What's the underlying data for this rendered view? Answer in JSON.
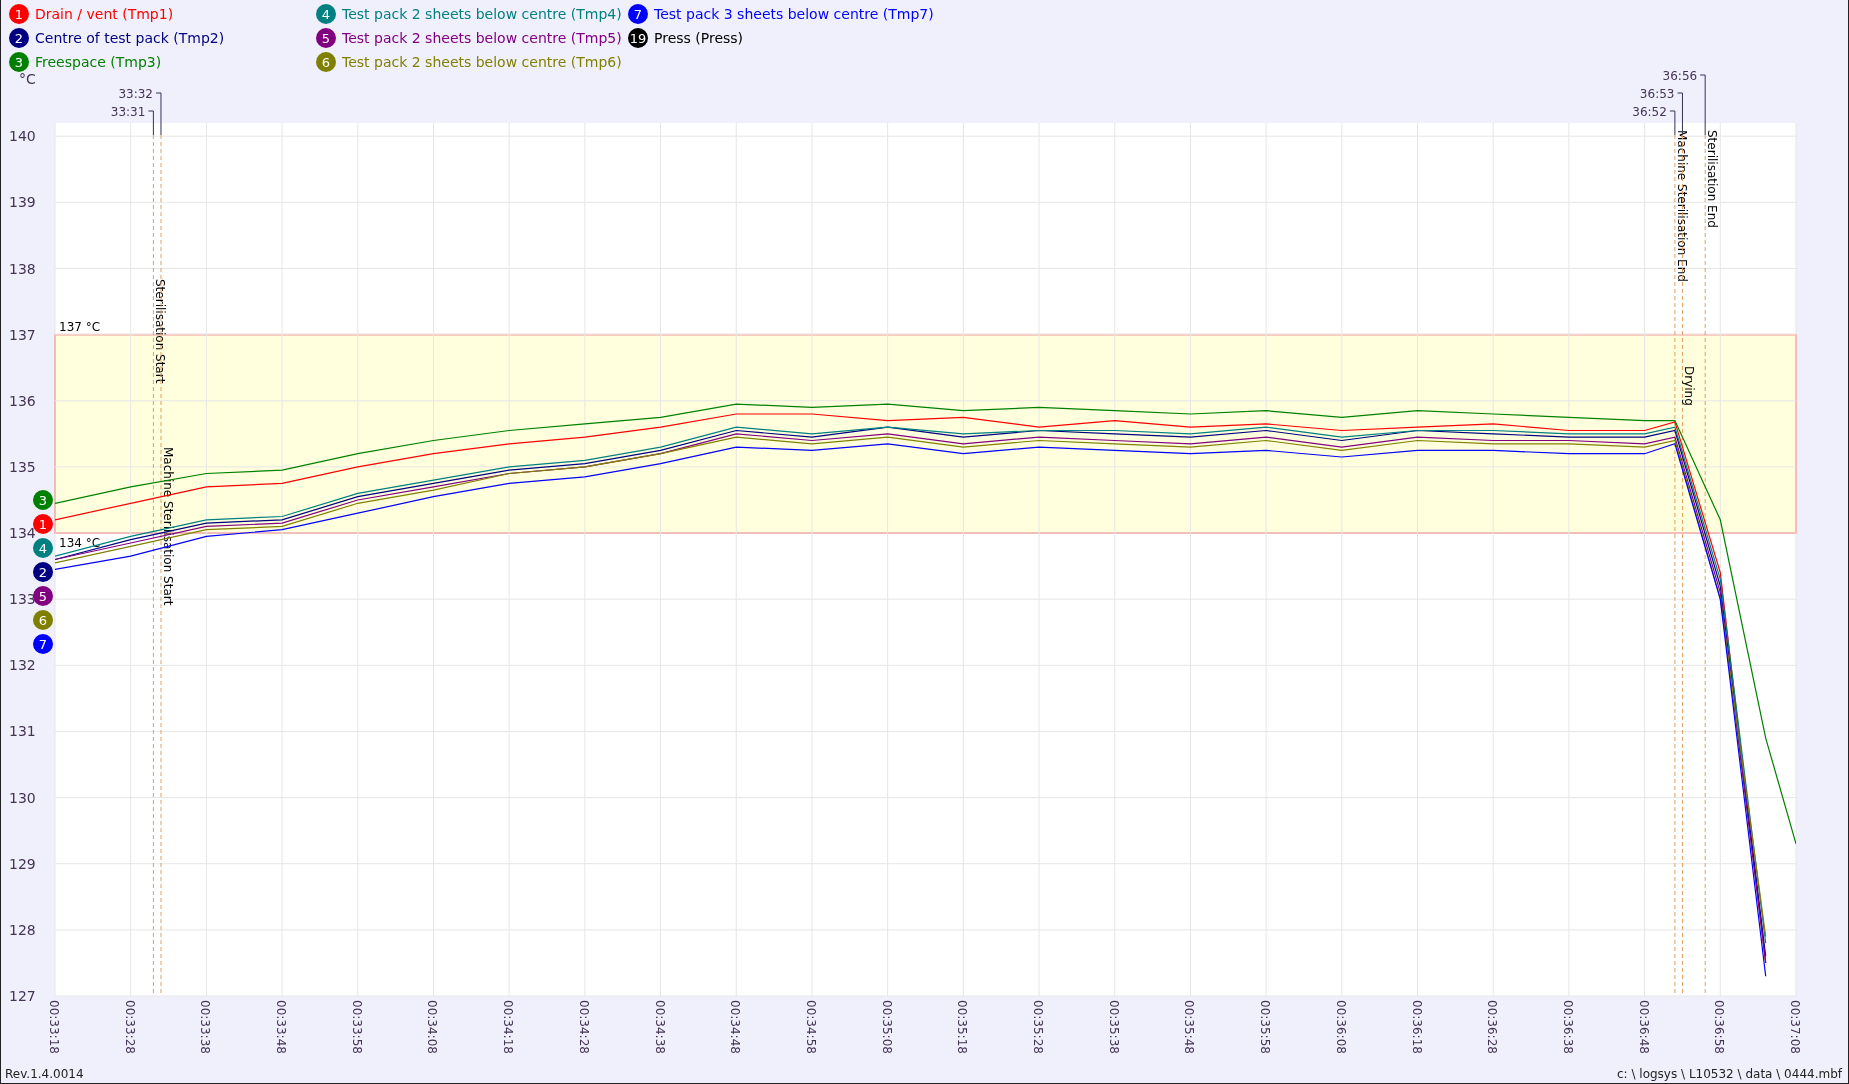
{
  "legend": [
    {
      "number": "1"
    },
    {
      "number": "2"
    },
    {
      "number": "3"
    },
    {
      "number": "4"
    },
    {
      "number": "5"
    },
    {
      "number": "6"
    },
    {
      "number": "7"
    }
  ],
  "extra_legend": {
    "number": "19",
    "label": "Press (Press)",
    "color": "#000000"
  },
  "series_badges": [
    {
      "text": "3",
      "color": "#008000"
    },
    {
      "text": "1",
      "color": "#ff0000"
    },
    {
      "text": "4",
      "color": "#008080"
    },
    {
      "text": "2",
      "color": "#000080"
    },
    {
      "text": "5",
      "color": "#800080"
    },
    {
      "text": "6",
      "color": "#808000"
    },
    {
      "text": "7",
      "color": "#0000ff"
    }
  ],
  "chart_data": {
    "type": "line",
    "ylabel": "°C",
    "x": [
      1998,
      2008,
      2018,
      2028,
      2038,
      2048,
      2058,
      2068,
      2078,
      2088,
      2098,
      2108,
      2118,
      2128,
      2138,
      2148,
      2158,
      2168,
      2178,
      2188,
      2198,
      2208,
      2212,
      2218,
      2224,
      2228
    ],
    "series": [
      {
        "name": "Drain / vent (Tmp1)",
        "color": "#ff0000",
        "values": [
          134.2,
          134.45,
          134.7,
          134.75,
          135.0,
          135.2,
          135.35,
          135.45,
          135.6,
          135.8,
          135.8,
          135.7,
          135.75,
          135.6,
          135.7,
          135.6,
          135.65,
          135.55,
          135.6,
          135.65,
          135.55,
          135.55,
          135.68,
          133.4,
          127.5,
          null
        ]
      },
      {
        "name": "Centre of test pack (Tmp2)",
        "color": "#000080",
        "values": [
          133.6,
          133.9,
          134.15,
          134.2,
          134.55,
          134.75,
          134.95,
          135.05,
          135.25,
          135.55,
          135.45,
          135.6,
          135.45,
          135.55,
          135.5,
          135.45,
          135.55,
          135.4,
          135.55,
          135.5,
          135.45,
          135.45,
          135.55,
          133.2,
          127.6,
          null
        ]
      },
      {
        "name": "Freespace (Tmp3)",
        "color": "#008000",
        "values": [
          134.45,
          134.7,
          134.9,
          134.95,
          135.2,
          135.4,
          135.55,
          135.65,
          135.75,
          135.95,
          135.9,
          135.95,
          135.85,
          135.9,
          135.85,
          135.8,
          135.85,
          135.75,
          135.85,
          135.8,
          135.75,
          135.7,
          135.7,
          134.2,
          130.9,
          129.3
        ]
      },
      {
        "name": "Test pack 2 sheets below centre (Tmp4)",
        "color": "#008080",
        "values": [
          133.65,
          133.95,
          134.2,
          134.25,
          134.6,
          134.8,
          135.0,
          135.1,
          135.3,
          135.6,
          135.5,
          135.6,
          135.5,
          135.55,
          135.55,
          135.5,
          135.6,
          135.45,
          135.55,
          135.55,
          135.5,
          135.5,
          135.6,
          133.3,
          127.8,
          null
        ]
      },
      {
        "name": "Test pack 2 sheets below centre (Tmp5)",
        "color": "#800080",
        "values": [
          133.6,
          133.85,
          134.1,
          134.15,
          134.5,
          134.7,
          134.9,
          135.0,
          135.2,
          135.5,
          135.4,
          135.5,
          135.35,
          135.45,
          135.4,
          135.35,
          135.45,
          135.3,
          135.45,
          135.4,
          135.4,
          135.35,
          135.45,
          133.1,
          127.5,
          null
        ]
      },
      {
        "name": "Test pack 2 sheets below centre (Tmp6)",
        "color": "#808000",
        "values": [
          133.55,
          133.8,
          134.05,
          134.1,
          134.45,
          134.65,
          134.9,
          135.0,
          135.2,
          135.45,
          135.35,
          135.45,
          135.3,
          135.4,
          135.35,
          135.3,
          135.4,
          135.25,
          135.4,
          135.35,
          135.35,
          135.3,
          135.4,
          133.0,
          127.9,
          null
        ]
      },
      {
        "name": "Test pack 3 sheets below centre (Tmp7)",
        "color": "#0000ff",
        "values": [
          133.45,
          133.65,
          133.95,
          134.05,
          134.3,
          134.55,
          134.75,
          134.85,
          135.05,
          135.3,
          135.25,
          135.35,
          135.2,
          135.3,
          135.25,
          135.2,
          135.25,
          135.15,
          135.25,
          135.25,
          135.2,
          135.2,
          135.35,
          133.0,
          127.3,
          null
        ]
      }
    ],
    "xlim": [
      1998,
      2228
    ],
    "ylim": [
      127,
      140.2
    ],
    "xticks": [
      {
        "value": 1998,
        "label": "00:33:18"
      },
      {
        "value": 2008,
        "label": "00:33:28"
      },
      {
        "value": 2018,
        "label": "00:33:38"
      },
      {
        "value": 2028,
        "label": "00:33:48"
      },
      {
        "value": 2038,
        "label": "00:33:58"
      },
      {
        "value": 2048,
        "label": "00:34:08"
      },
      {
        "value": 2058,
        "label": "00:34:18"
      },
      {
        "value": 2068,
        "label": "00:34:28"
      },
      {
        "value": 2078,
        "label": "00:34:38"
      },
      {
        "value": 2088,
        "label": "00:34:48"
      },
      {
        "value": 2098,
        "label": "00:34:58"
      },
      {
        "value": 2108,
        "label": "00:35:08"
      },
      {
        "value": 2118,
        "label": "00:35:18"
      },
      {
        "value": 2128,
        "label": "00:35:28"
      },
      {
        "value": 2138,
        "label": "00:35:38"
      },
      {
        "value": 2148,
        "label": "00:35:48"
      },
      {
        "value": 2158,
        "label": "00:35:58"
      },
      {
        "value": 2168,
        "label": "00:36:08"
      },
      {
        "value": 2178,
        "label": "00:36:18"
      },
      {
        "value": 2188,
        "label": "00:36:28"
      },
      {
        "value": 2198,
        "label": "00:36:38"
      },
      {
        "value": 2208,
        "label": "00:36:48"
      },
      {
        "value": 2218,
        "label": "00:36:58"
      },
      {
        "value": 2228,
        "label": "00:37:08"
      }
    ],
    "yticks": [
      127,
      128,
      129,
      130,
      131,
      132,
      133,
      134,
      135,
      136,
      137,
      138,
      139,
      140
    ],
    "grid": true,
    "bands": [
      {
        "axis": "y",
        "from": 134,
        "to": 137
      }
    ],
    "ref_lines": [
      {
        "axis": "x",
        "value": 2011,
        "label": "Sterilisation Start"
      },
      {
        "axis": "x",
        "value": 2012,
        "label": "Machine Sterilisation Start"
      },
      {
        "axis": "x",
        "value": 2212,
        "label": "Machine Sterilisation End"
      },
      {
        "axis": "x",
        "value": 2213,
        "label": "Drying"
      },
      {
        "axis": "x",
        "value": 2216,
        "label": "Sterilisation End"
      }
    ]
  },
  "band_labels": [
    {
      "text": "137 °C"
    },
    {
      "text": "134 °C"
    }
  ],
  "event_times": [
    {
      "text": "33:31"
    },
    {
      "text": "33:32"
    },
    {
      "text": "36:52"
    },
    {
      "text": "36:53"
    },
    {
      "text": "36:56"
    }
  ],
  "footer": {
    "revision": "Rev.1.4.0014",
    "file_path": "c: \\ logsys \\ L10532 \\ data \\ 0444.mbf"
  }
}
